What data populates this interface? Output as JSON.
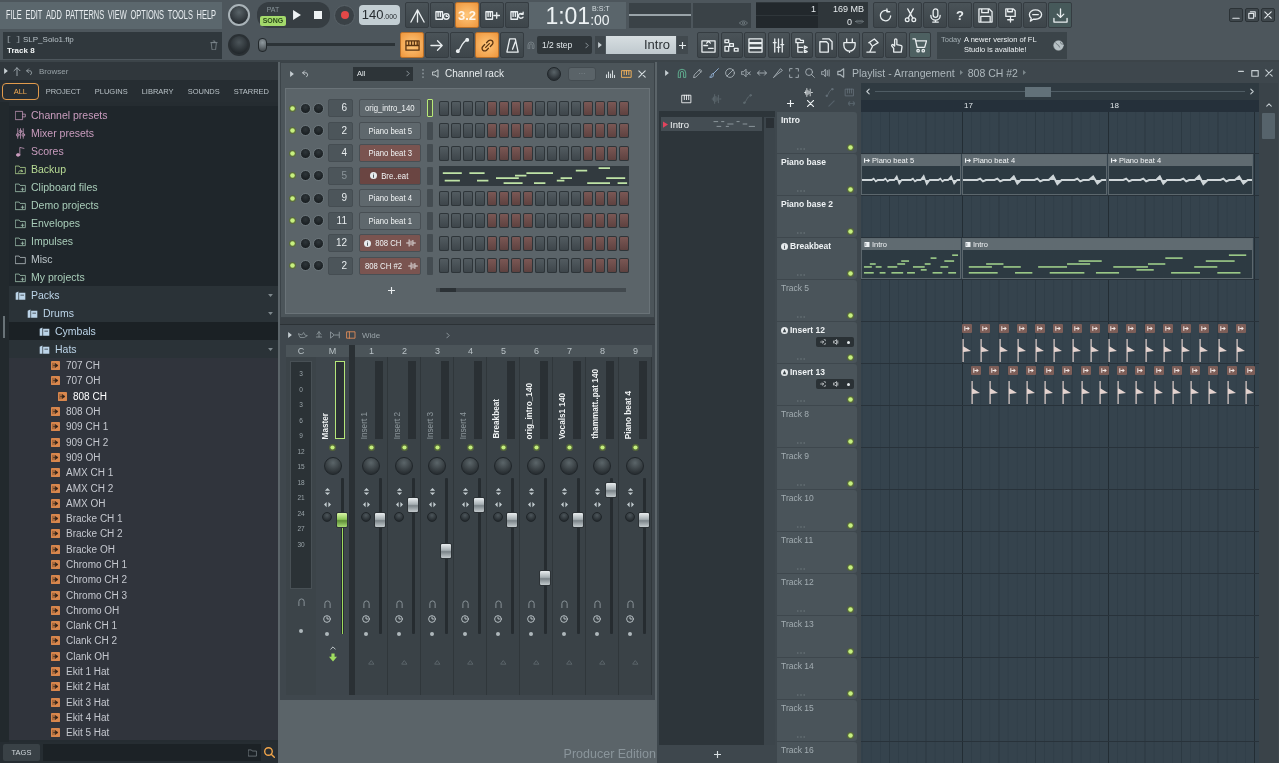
{
  "menu": [
    "FILE",
    "EDIT",
    "ADD",
    "PATTERNS",
    "VIEW",
    "OPTIONS",
    "TOOLS",
    "HELP"
  ],
  "project": {
    "file": "SLP_Solo1.flp",
    "hint": "Track 8"
  },
  "transport": {
    "modes": [
      {
        "label": "PAT",
        "selected": false
      },
      {
        "label": "SONG",
        "selected": true
      }
    ],
    "tempo": "140",
    "tempo_fraction": ".000",
    "time_format": "B:S:T",
    "time": "1:01",
    "time_ticks": ":00"
  },
  "record_tools": [
    {
      "kind": "peak",
      "on": false
    },
    {
      "kind": "keys-clock",
      "on": false
    },
    {
      "kind": "countdown",
      "glyph": "3.2",
      "on": true
    },
    {
      "kind": "keys-plus",
      "on": false
    },
    {
      "kind": "keys-loop",
      "on": false
    }
  ],
  "monitor": {
    "cpu": "1",
    "memory": "169 MB",
    "voices": "0"
  },
  "app_tools": [
    {
      "kind": "refresh"
    },
    {
      "kind": "scissors"
    },
    {
      "kind": "microphone"
    },
    {
      "kind": "help",
      "glyph": "?"
    },
    {
      "kind": "save"
    },
    {
      "kind": "save-export"
    },
    {
      "kind": "chat"
    },
    {
      "kind": "download"
    }
  ],
  "master_pitch": {
    "level": 0
  },
  "edit_tools": [
    {
      "kind": "keyboard",
      "on": true
    },
    {
      "kind": "arrow",
      "on": false
    },
    {
      "kind": "curve",
      "on": false
    },
    {
      "kind": "link",
      "on": true
    },
    {
      "kind": "metronome",
      "on": false
    }
  ],
  "snap": "1/2 step",
  "pattern": "Intro",
  "window_tools": [
    {
      "kind": "playlist"
    },
    {
      "kind": "piano-roll"
    },
    {
      "kind": "channel-list"
    },
    {
      "kind": "mixer"
    },
    {
      "kind": "browser"
    },
    {
      "kind": "document"
    },
    {
      "kind": "plug"
    },
    {
      "kind": "lamp"
    },
    {
      "kind": "hand"
    },
    {
      "kind": "cart"
    }
  ],
  "news": {
    "day": "Today",
    "message": "A newer version of FL Studio is available!"
  },
  "browser": {
    "title": "Browser",
    "tabs": [
      {
        "label": "ALL",
        "selected": true
      },
      {
        "label": "PROJECT",
        "selected": false
      },
      {
        "label": "PLUGINS",
        "selected": false
      },
      {
        "label": "LIBRARY",
        "selected": false
      },
      {
        "label": "SOUNDS",
        "selected": false
      },
      {
        "label": "STARRED",
        "selected": false
      }
    ],
    "tree": [
      {
        "label": "Channel presets",
        "kind": "preset-channel",
        "selected": false
      },
      {
        "label": "Mixer presets",
        "kind": "preset-mixer",
        "selected": false
      },
      {
        "label": "Scores",
        "kind": "score",
        "selected": false
      },
      {
        "label": "Backup",
        "kind": "backup",
        "selected": false
      },
      {
        "label": "Clipboard files",
        "kind": "folder",
        "selected": false
      },
      {
        "label": "Demo projects",
        "kind": "folder",
        "selected": false
      },
      {
        "label": "Envelopes",
        "kind": "folder",
        "selected": false
      },
      {
        "label": "Impulses",
        "kind": "folder",
        "selected": false
      },
      {
        "label": "Misc",
        "kind": "plain-folder",
        "selected": false
      },
      {
        "label": "My projects",
        "kind": "folder",
        "selected": false
      },
      {
        "label": "Packs",
        "kind": "pack",
        "selected": false,
        "expanded": true,
        "highlighted": false,
        "children": [
          {
            "label": "Drums",
            "kind": "pack",
            "selected": false,
            "expanded": true,
            "highlighted": false,
            "children": [
              {
                "label": "Cymbals",
                "kind": "pack",
                "selected": false,
                "expanded": false,
                "highlighted": true
              },
              {
                "label": "Hats",
                "kind": "pack",
                "selected": false,
                "expanded": true,
                "highlighted": false,
                "children": [
                  {
                    "label": "707 CH",
                    "kind": "sample",
                    "selected": false
                  },
                  {
                    "label": "707 OH",
                    "kind": "sample",
                    "selected": false
                  },
                  {
                    "label": "808 CH",
                    "kind": "sample",
                    "selected": true
                  },
                  {
                    "label": "808 OH",
                    "kind": "sample",
                    "selected": false
                  },
                  {
                    "label": "909 CH 1",
                    "kind": "sample",
                    "selected": false
                  },
                  {
                    "label": "909 CH 2",
                    "kind": "sample",
                    "selected": false
                  },
                  {
                    "label": "909 OH",
                    "kind": "sample",
                    "selected": false
                  },
                  {
                    "label": "AMX CH 1",
                    "kind": "sample",
                    "selected": false
                  },
                  {
                    "label": "AMX CH 2",
                    "kind": "sample",
                    "selected": false
                  },
                  {
                    "label": "AMX OH",
                    "kind": "sample",
                    "selected": false
                  },
                  {
                    "label": "Bracke CH 1",
                    "kind": "sample",
                    "selected": false
                  },
                  {
                    "label": "Bracke CH 2",
                    "kind": "sample",
                    "selected": false
                  },
                  {
                    "label": "Bracke OH",
                    "kind": "sample",
                    "selected": false
                  },
                  {
                    "label": "Chromo CH 1",
                    "kind": "sample",
                    "selected": false
                  },
                  {
                    "label": "Chromo CH 2",
                    "kind": "sample",
                    "selected": false
                  },
                  {
                    "label": "Chromo CH 3",
                    "kind": "sample",
                    "selected": false
                  },
                  {
                    "label": "Chromo OH",
                    "kind": "sample",
                    "selected": false
                  },
                  {
                    "label": "Clank CH 1",
                    "kind": "sample",
                    "selected": false
                  },
                  {
                    "label": "Clank CH 2",
                    "kind": "sample",
                    "selected": false
                  },
                  {
                    "label": "Clank OH",
                    "kind": "sample",
                    "selected": false
                  },
                  {
                    "label": "Ekit 1 Hat",
                    "kind": "sample",
                    "selected": false
                  },
                  {
                    "label": "Ekit 2 Hat",
                    "kind": "sample",
                    "selected": false
                  },
                  {
                    "label": "Ekit 3 Hat",
                    "kind": "sample",
                    "selected": false
                  },
                  {
                    "label": "Ekit 4 Hat",
                    "kind": "sample",
                    "selected": false
                  },
                  {
                    "label": "Ekit 5 Hat",
                    "kind": "sample",
                    "selected": false
                  }
                ]
              }
            ]
          }
        ]
      }
    ],
    "tags": "TAGS"
  },
  "channel_rack": {
    "filter": "All",
    "title": "Channel rack",
    "channels": [
      {
        "number": "6",
        "name": "orig_intro_140",
        "color": "#5f686d",
        "kind": "steps",
        "selected": true,
        "dim": false,
        "info": false,
        "wave": false
      },
      {
        "number": "2",
        "name": "Piano beat 5",
        "color": "#5f686d",
        "kind": "steps",
        "selected": false,
        "dim": false,
        "info": false,
        "wave": false
      },
      {
        "number": "4",
        "name": "Piano beat 3",
        "color": "#7a5450",
        "kind": "steps",
        "selected": false,
        "dim": false,
        "info": false,
        "wave": false
      },
      {
        "number": "5",
        "name": "Bre..eat",
        "color": "#6a4542",
        "kind": "pianoroll",
        "selected": false,
        "dim": true,
        "info": true,
        "wave": false
      },
      {
        "number": "9",
        "name": "Piano beat 4",
        "color": "#5f686d",
        "kind": "steps",
        "selected": false,
        "dim": false,
        "info": false,
        "wave": false
      },
      {
        "number": "11",
        "name": "Piano beat 1",
        "color": "#5f686d",
        "kind": "steps",
        "selected": false,
        "dim": false,
        "info": false,
        "wave": false
      },
      {
        "number": "12",
        "name": "808 CH",
        "color": "#7a5450",
        "kind": "steps",
        "selected": false,
        "dim": false,
        "info": true,
        "wave": true
      },
      {
        "number": "2",
        "name": "808 CH #2",
        "color": "#7a5450",
        "kind": "steps",
        "selected": false,
        "dim": false,
        "info": false,
        "wave": true
      }
    ]
  },
  "mixer": {
    "preset": "Wide",
    "scale_label": "C",
    "scale": [
      "3",
      "0",
      "3",
      "6",
      "9",
      "12",
      "15",
      "18",
      "21",
      "24",
      "27",
      "30"
    ],
    "tracks": [
      {
        "slot": "M",
        "name": "Master",
        "kind": "master",
        "selected": true,
        "used": true,
        "level": 0.73
      },
      {
        "slot": "1",
        "name": "Insert 1",
        "kind": "insert",
        "selected": false,
        "used": false,
        "level": 0.73
      },
      {
        "slot": "2",
        "name": "Insert 2",
        "kind": "insert",
        "selected": false,
        "used": false,
        "level": 0.83
      },
      {
        "slot": "3",
        "name": "Insert 3",
        "kind": "insert",
        "selected": false,
        "used": false,
        "level": 0.53
      },
      {
        "slot": "4",
        "name": "Insert 4",
        "kind": "insert",
        "selected": false,
        "used": false,
        "level": 0.83
      },
      {
        "slot": "5",
        "name": "Breakbeat",
        "kind": "insert",
        "selected": false,
        "used": true,
        "level": 0.73
      },
      {
        "slot": "6",
        "name": "orig_intro_140",
        "kind": "insert",
        "selected": false,
        "used": true,
        "level": 0.36
      },
      {
        "slot": "7",
        "name": "Vocals1 140",
        "kind": "insert",
        "selected": false,
        "used": true,
        "level": 0.73
      },
      {
        "slot": "8",
        "name": "thammatt..pat 140",
        "kind": "insert",
        "selected": false,
        "used": true,
        "level": 0.92
      },
      {
        "slot": "9",
        "name": "Piano beat 4",
        "kind": "insert",
        "selected": false,
        "used": true,
        "level": 0.73
      }
    ]
  },
  "edition": "Producer Edition",
  "playlist": {
    "title": "Playlist - Arrangement",
    "crumb": "808 CH #2",
    "tools": [
      {
        "kind": "magnet",
        "selected": false
      },
      {
        "kind": "pencil",
        "selected": false
      },
      {
        "kind": "brush",
        "selected": true
      },
      {
        "kind": "delete",
        "selected": false
      },
      {
        "kind": "mute",
        "selected": false
      },
      {
        "kind": "slip",
        "selected": false
      },
      {
        "kind": "slice",
        "selected": false
      },
      {
        "kind": "select",
        "selected": false
      },
      {
        "kind": "zoom",
        "selected": false
      },
      {
        "kind": "playback",
        "selected": false
      }
    ],
    "filters": [
      {
        "kind": "keys",
        "selected": true
      },
      {
        "kind": "wave",
        "selected": false
      },
      {
        "kind": "curve",
        "selected": false
      }
    ],
    "patterns": [
      {
        "name": "Intro",
        "selected": true
      }
    ],
    "ruler": [
      "17",
      "18"
    ],
    "tracks": [
      {
        "name": "Intro",
        "empty": false,
        "controls": false,
        "info": false,
        "linked": false
      },
      {
        "name": "Piano base",
        "empty": false,
        "controls": false,
        "info": false,
        "linked": false,
        "clips": [
          {
            "label": "Piano beat 5",
            "kind": "audio",
            "cut": true
          },
          {
            "label": "Piano beat 4",
            "kind": "audio",
            "cut": false
          },
          {
            "label": "Piano beat 4",
            "kind": "audio",
            "cut": false
          }
        ]
      },
      {
        "name": "Piano base 2",
        "empty": false,
        "controls": false,
        "info": false,
        "linked": false
      },
      {
        "name": "Breakbeat",
        "empty": false,
        "controls": false,
        "info": true,
        "linked": false,
        "clips": [
          {
            "label": "Intro",
            "kind": "pattern",
            "cut": true
          },
          {
            "label": "Intro",
            "kind": "pattern",
            "cut": false
          }
        ]
      },
      {
        "name": "Track 5",
        "empty": true,
        "controls": false,
        "info": false,
        "linked": false
      },
      {
        "name": "Insert 12",
        "empty": false,
        "controls": true,
        "info": false,
        "linked": true,
        "offbeat": false,
        "clips": [
          {
            "kind": "slice",
            "cut": false
          },
          {
            "kind": "slice",
            "cut": false
          },
          {
            "kind": "slice",
            "cut": false
          },
          {
            "kind": "slice",
            "cut": false
          },
          {
            "kind": "slice",
            "cut": false
          },
          {
            "kind": "slice",
            "cut": false
          },
          {
            "kind": "slice",
            "cut": false
          },
          {
            "kind": "slice",
            "cut": false
          },
          {
            "kind": "slice",
            "cut": false
          },
          {
            "kind": "slice",
            "cut": false
          },
          {
            "kind": "slice",
            "cut": false
          },
          {
            "kind": "slice",
            "cut": false
          },
          {
            "kind": "slice",
            "cut": false
          },
          {
            "kind": "slice",
            "cut": false
          },
          {
            "kind": "slice",
            "cut": false
          },
          {
            "kind": "slice",
            "cut": false
          }
        ]
      },
      {
        "name": "Insert 13",
        "empty": false,
        "controls": true,
        "info": false,
        "linked": true,
        "offbeat": true,
        "clips": [
          {
            "kind": "slice",
            "cut": false
          },
          {
            "kind": "slice",
            "cut": false
          },
          {
            "kind": "slice",
            "cut": false
          },
          {
            "kind": "slice",
            "cut": false
          },
          {
            "kind": "slice",
            "cut": false
          },
          {
            "kind": "slice",
            "cut": false
          },
          {
            "kind": "slice",
            "cut": false
          },
          {
            "kind": "slice",
            "cut": false
          },
          {
            "kind": "slice",
            "cut": false
          },
          {
            "kind": "slice",
            "cut": false
          },
          {
            "kind": "slice",
            "cut": false
          },
          {
            "kind": "slice",
            "cut": false
          },
          {
            "kind": "slice",
            "cut": false
          },
          {
            "kind": "slice",
            "cut": false
          },
          {
            "kind": "slice",
            "cut": false
          },
          {
            "kind": "slice",
            "cut": false
          }
        ]
      },
      {
        "name": "Track 8",
        "empty": true,
        "controls": false,
        "info": false,
        "linked": false
      },
      {
        "name": "Track 9",
        "empty": true,
        "controls": false,
        "info": false,
        "linked": false
      },
      {
        "name": "Track 10",
        "empty": true,
        "controls": false,
        "info": false,
        "linked": false
      },
      {
        "name": "Track 11",
        "empty": true,
        "controls": false,
        "info": false,
        "linked": false
      },
      {
        "name": "Track 12",
        "empty": true,
        "controls": false,
        "info": false,
        "linked": false
      },
      {
        "name": "Track 13",
        "empty": true,
        "controls": false,
        "info": false,
        "linked": false
      },
      {
        "name": "Track 14",
        "empty": true,
        "controls": false,
        "info": false,
        "linked": false
      },
      {
        "name": "Track 15",
        "empty": true,
        "controls": false,
        "info": false,
        "linked": false
      },
      {
        "name": "Track 16",
        "empty": true,
        "controls": false,
        "info": false,
        "linked": false
      }
    ]
  }
}
